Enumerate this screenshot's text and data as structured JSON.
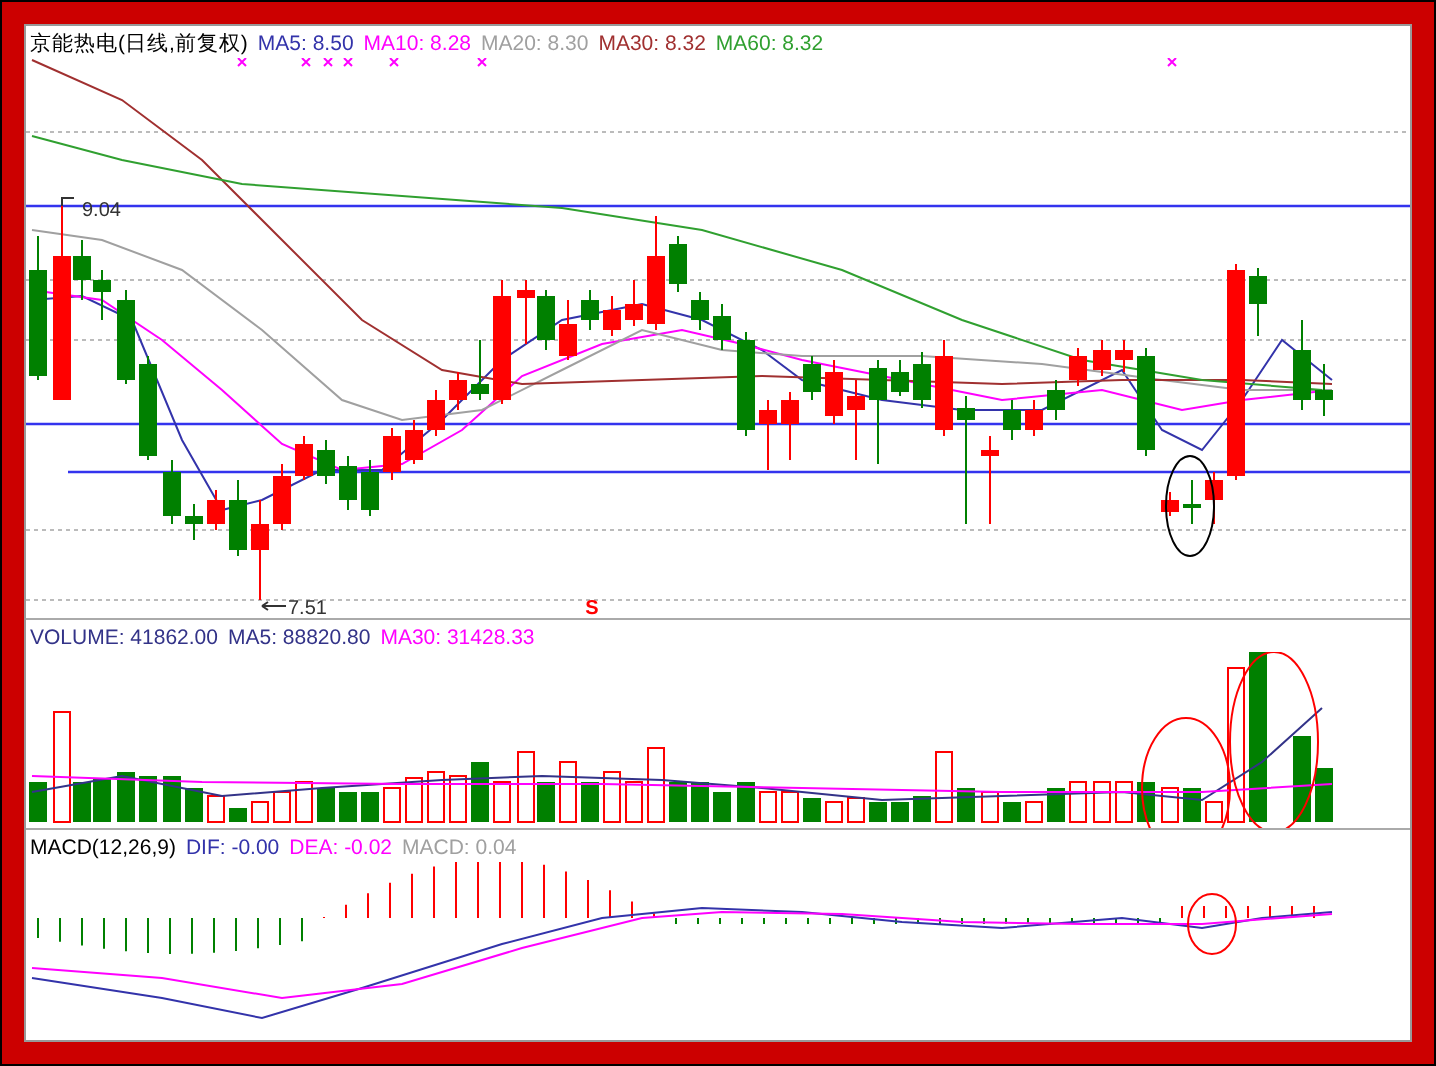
{
  "price_header": {
    "title": "京能热电(日线,前复权)",
    "indicators": [
      {
        "label": "MA5: 8.50",
        "color": "#3333aa"
      },
      {
        "label": "MA10: 8.28",
        "color": "#ff00ff"
      },
      {
        "label": "MA20: 8.30",
        "color": "#a0a0a0"
      },
      {
        "label": "MA30: 8.32",
        "color": "#a03030"
      },
      {
        "label": "MA60: 8.32",
        "color": "#30a030"
      }
    ]
  },
  "price_marks": {
    "high": "9.04",
    "low": "7.51"
  },
  "signal_marker": "S",
  "volume_header": {
    "indicators": [
      {
        "label": "VOLUME: 41862.00",
        "color": "#333388"
      },
      {
        "label": "MA5: 88820.80",
        "color": "#333388"
      },
      {
        "label": "MA30: 31428.33",
        "color": "#ff00ff"
      }
    ]
  },
  "macd_header": {
    "title": "MACD(12,26,9)",
    "indicators": [
      {
        "label": "DIF: -0.00",
        "color": "#3333aa"
      },
      {
        "label": "DEA: -0.02",
        "color": "#ff00ff"
      },
      {
        "label": "MACD: 0.04",
        "color": "#a0a0a0"
      }
    ]
  }
}
